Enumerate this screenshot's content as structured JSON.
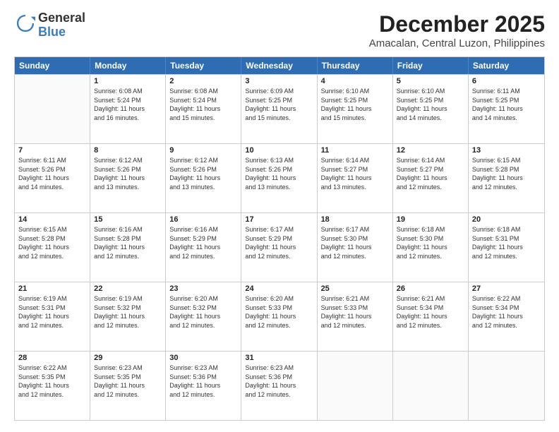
{
  "logo": {
    "line1": "General",
    "line2": "Blue"
  },
  "title": "December 2025",
  "subtitle": "Amacalan, Central Luzon, Philippines",
  "header_days": [
    "Sunday",
    "Monday",
    "Tuesday",
    "Wednesday",
    "Thursday",
    "Friday",
    "Saturday"
  ],
  "weeks": [
    [
      {
        "day": "",
        "info": ""
      },
      {
        "day": "1",
        "info": "Sunrise: 6:08 AM\nSunset: 5:24 PM\nDaylight: 11 hours\nand 16 minutes."
      },
      {
        "day": "2",
        "info": "Sunrise: 6:08 AM\nSunset: 5:24 PM\nDaylight: 11 hours\nand 15 minutes."
      },
      {
        "day": "3",
        "info": "Sunrise: 6:09 AM\nSunset: 5:25 PM\nDaylight: 11 hours\nand 15 minutes."
      },
      {
        "day": "4",
        "info": "Sunrise: 6:10 AM\nSunset: 5:25 PM\nDaylight: 11 hours\nand 15 minutes."
      },
      {
        "day": "5",
        "info": "Sunrise: 6:10 AM\nSunset: 5:25 PM\nDaylight: 11 hours\nand 14 minutes."
      },
      {
        "day": "6",
        "info": "Sunrise: 6:11 AM\nSunset: 5:25 PM\nDaylight: 11 hours\nand 14 minutes."
      }
    ],
    [
      {
        "day": "7",
        "info": "Sunrise: 6:11 AM\nSunset: 5:26 PM\nDaylight: 11 hours\nand 14 minutes."
      },
      {
        "day": "8",
        "info": "Sunrise: 6:12 AM\nSunset: 5:26 PM\nDaylight: 11 hours\nand 13 minutes."
      },
      {
        "day": "9",
        "info": "Sunrise: 6:12 AM\nSunset: 5:26 PM\nDaylight: 11 hours\nand 13 minutes."
      },
      {
        "day": "10",
        "info": "Sunrise: 6:13 AM\nSunset: 5:26 PM\nDaylight: 11 hours\nand 13 minutes."
      },
      {
        "day": "11",
        "info": "Sunrise: 6:14 AM\nSunset: 5:27 PM\nDaylight: 11 hours\nand 13 minutes."
      },
      {
        "day": "12",
        "info": "Sunrise: 6:14 AM\nSunset: 5:27 PM\nDaylight: 11 hours\nand 12 minutes."
      },
      {
        "day": "13",
        "info": "Sunrise: 6:15 AM\nSunset: 5:28 PM\nDaylight: 11 hours\nand 12 minutes."
      }
    ],
    [
      {
        "day": "14",
        "info": "Sunrise: 6:15 AM\nSunset: 5:28 PM\nDaylight: 11 hours\nand 12 minutes."
      },
      {
        "day": "15",
        "info": "Sunrise: 6:16 AM\nSunset: 5:28 PM\nDaylight: 11 hours\nand 12 minutes."
      },
      {
        "day": "16",
        "info": "Sunrise: 6:16 AM\nSunset: 5:29 PM\nDaylight: 11 hours\nand 12 minutes."
      },
      {
        "day": "17",
        "info": "Sunrise: 6:17 AM\nSunset: 5:29 PM\nDaylight: 11 hours\nand 12 minutes."
      },
      {
        "day": "18",
        "info": "Sunrise: 6:17 AM\nSunset: 5:30 PM\nDaylight: 11 hours\nand 12 minutes."
      },
      {
        "day": "19",
        "info": "Sunrise: 6:18 AM\nSunset: 5:30 PM\nDaylight: 11 hours\nand 12 minutes."
      },
      {
        "day": "20",
        "info": "Sunrise: 6:18 AM\nSunset: 5:31 PM\nDaylight: 11 hours\nand 12 minutes."
      }
    ],
    [
      {
        "day": "21",
        "info": "Sunrise: 6:19 AM\nSunset: 5:31 PM\nDaylight: 11 hours\nand 12 minutes."
      },
      {
        "day": "22",
        "info": "Sunrise: 6:19 AM\nSunset: 5:32 PM\nDaylight: 11 hours\nand 12 minutes."
      },
      {
        "day": "23",
        "info": "Sunrise: 6:20 AM\nSunset: 5:32 PM\nDaylight: 11 hours\nand 12 minutes."
      },
      {
        "day": "24",
        "info": "Sunrise: 6:20 AM\nSunset: 5:33 PM\nDaylight: 11 hours\nand 12 minutes."
      },
      {
        "day": "25",
        "info": "Sunrise: 6:21 AM\nSunset: 5:33 PM\nDaylight: 11 hours\nand 12 minutes."
      },
      {
        "day": "26",
        "info": "Sunrise: 6:21 AM\nSunset: 5:34 PM\nDaylight: 11 hours\nand 12 minutes."
      },
      {
        "day": "27",
        "info": "Sunrise: 6:22 AM\nSunset: 5:34 PM\nDaylight: 11 hours\nand 12 minutes."
      }
    ],
    [
      {
        "day": "28",
        "info": "Sunrise: 6:22 AM\nSunset: 5:35 PM\nDaylight: 11 hours\nand 12 minutes."
      },
      {
        "day": "29",
        "info": "Sunrise: 6:23 AM\nSunset: 5:35 PM\nDaylight: 11 hours\nand 12 minutes."
      },
      {
        "day": "30",
        "info": "Sunrise: 6:23 AM\nSunset: 5:36 PM\nDaylight: 11 hours\nand 12 minutes."
      },
      {
        "day": "31",
        "info": "Sunrise: 6:23 AM\nSunset: 5:36 PM\nDaylight: 11 hours\nand 12 minutes."
      },
      {
        "day": "",
        "info": ""
      },
      {
        "day": "",
        "info": ""
      },
      {
        "day": "",
        "info": ""
      }
    ]
  ]
}
